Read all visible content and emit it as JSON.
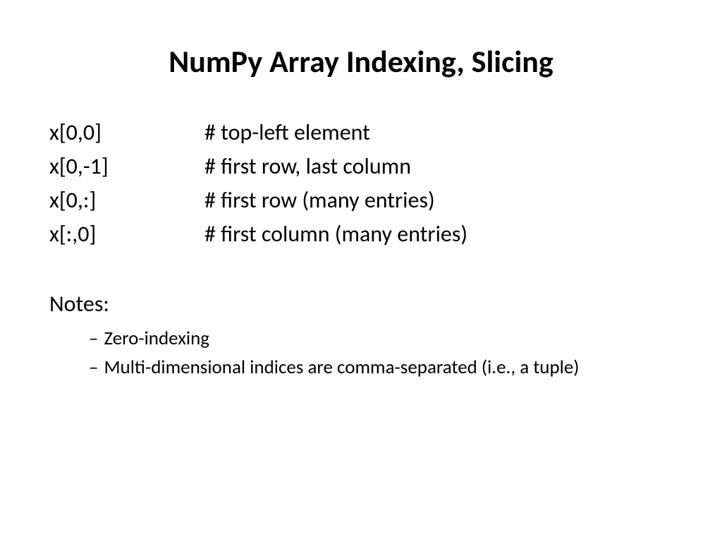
{
  "title": "NumPy Array Indexing, Slicing",
  "examples": [
    {
      "code": "x[0,0]",
      "comment": "# top-left element"
    },
    {
      "code": "x[0,-1]",
      "comment": "# first row, last column"
    },
    {
      "code": "x[0,:]",
      "comment": "# first row (many entries)"
    },
    {
      "code": "x[:,0]",
      "comment": "# first column (many entries)"
    }
  ],
  "notes_label": "Notes:",
  "notes": [
    "Zero-indexing",
    "Multi-dimensional indices are comma-separated (i.e., a tuple)"
  ]
}
